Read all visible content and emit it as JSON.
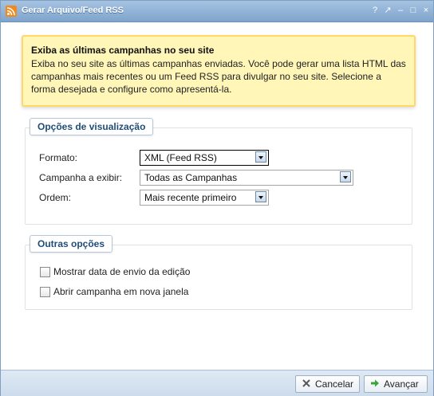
{
  "window": {
    "title": "Gerar Arquivo/Feed RSS",
    "controls": [
      "?",
      "↗",
      "–",
      "□",
      "×"
    ]
  },
  "notice": {
    "heading": "Exiba as últimas campanhas no seu site",
    "body": "Exiba no seu site as últimas campanhas enviadas. Você pode gerar uma lista HTML das campanhas mais recentes ou um Feed RSS para divulgar no seu site. Selecione a forma desejada e configure como apresentá-la."
  },
  "display_options": {
    "legend": "Opções de visualização",
    "format_label": "Formato:",
    "format_value": "XML (Feed RSS)",
    "campaign_label": "Campanha a exibir:",
    "campaign_value": "Todas as Campanhas",
    "order_label": "Ordem:",
    "order_value": "Mais recente primeiro"
  },
  "other_options": {
    "legend": "Outras opções",
    "show_date_label": "Mostrar data de envio da edição",
    "show_date_checked": false,
    "new_window_label": "Abrir campanha em nova janela",
    "new_window_checked": false
  },
  "footer": {
    "cancel_label": "Cancelar",
    "next_label": "Avançar"
  },
  "colors": {
    "title_bar": "#8fb0d6",
    "notice_bg": "#fff6b8",
    "notice_border": "#ffd86a",
    "legend_text": "#1f4d7a"
  }
}
